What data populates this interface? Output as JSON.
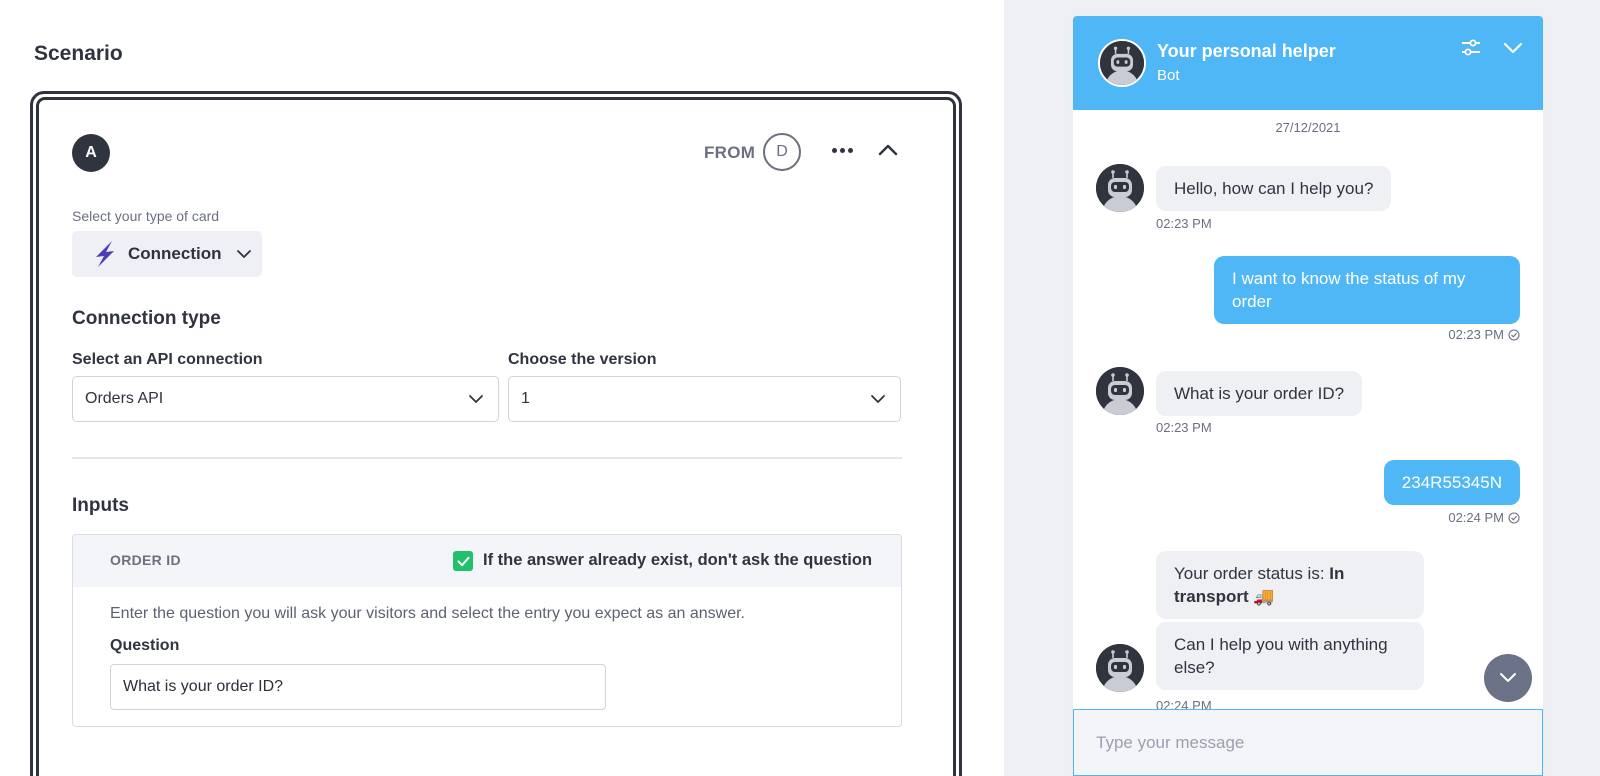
{
  "scenario": {
    "title": "Scenario",
    "step_badge": "A",
    "from_label": "FROM",
    "from_badge": "D",
    "card_type_label": "Select your type of card",
    "card_type_value": "Connection",
    "connection_type_heading": "Connection type",
    "api_label": "Select an API connection",
    "api_value": "Orders API",
    "version_label": "Choose the version",
    "version_value": "1",
    "inputs_heading": "Inputs",
    "input_row": {
      "name": "ORDER ID",
      "checkbox_checked": true,
      "checkbox_label": "If the answer already exist, don't ask the question",
      "description": "Enter the question you will ask your visitors and select the entry you expect as an answer.",
      "question_label": "Question",
      "question_value": "What is your order ID?"
    }
  },
  "chat": {
    "header_name": "Your personal helper",
    "header_role": "Bot",
    "header_color": "#4fb7f6",
    "date": "27/12/2021",
    "messages": [
      {
        "from": "bot",
        "text": "Hello, how can I help you?",
        "time": "02:23 PM"
      },
      {
        "from": "user",
        "text": "I want to know the status of my order",
        "time": "02:23 PM"
      },
      {
        "from": "bot",
        "text": "What is your order ID?",
        "time": "02:23 PM"
      },
      {
        "from": "user",
        "text": "234R55345N",
        "time": "02:24 PM"
      },
      {
        "from": "bot",
        "text_prefix": "Your order status is: ",
        "text_bold": "In transport",
        "emoji": "🚚"
      },
      {
        "from": "bot",
        "text": "Can I help you with anything else?",
        "time": "02:24 PM"
      }
    ],
    "input_placeholder": "Type your message"
  }
}
